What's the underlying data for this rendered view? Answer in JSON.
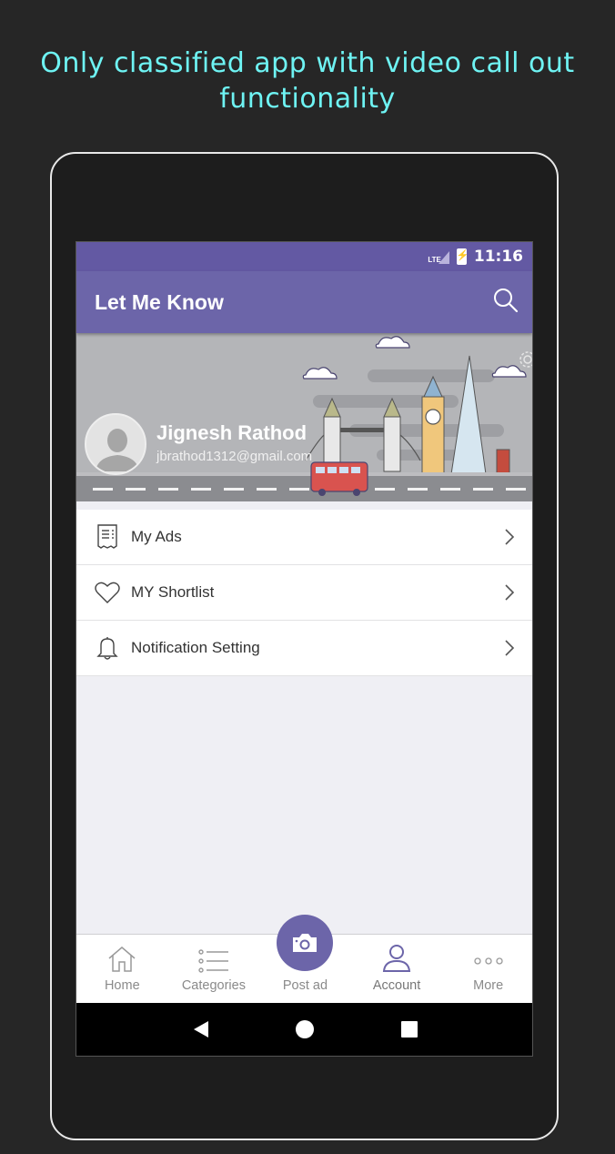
{
  "promo": {
    "line1": "Only classified app with video call out",
    "line2": "functionality"
  },
  "status_bar": {
    "network": "LTE",
    "time": "11:16"
  },
  "app_bar": {
    "title": "Let Me Know",
    "search_icon": "search-icon"
  },
  "profile": {
    "name": "Jignesh Rathod",
    "email": "jbrathod1312@gmail.com",
    "avatar_icon": "person-icon",
    "settings_icon": "gear-icon"
  },
  "menu": [
    {
      "label": "My Ads",
      "icon": "receipt-icon"
    },
    {
      "label": "MY Shortlist",
      "icon": "heart-icon"
    },
    {
      "label": "Notification Setting",
      "icon": "bell-icon"
    }
  ],
  "bottom_nav": [
    {
      "label": "Home",
      "icon": "home-icon",
      "active": false
    },
    {
      "label": "Categories",
      "icon": "list-icon",
      "active": false
    },
    {
      "label": "Post ad",
      "icon": "camera-icon",
      "active": false
    },
    {
      "label": "Account",
      "icon": "person-icon",
      "active": true
    },
    {
      "label": "More",
      "icon": "more-icon",
      "active": false
    }
  ],
  "colors": {
    "primary": "#6c65a9",
    "status_bar": "#6359a3",
    "promo_text": "#6ef3f3"
  }
}
